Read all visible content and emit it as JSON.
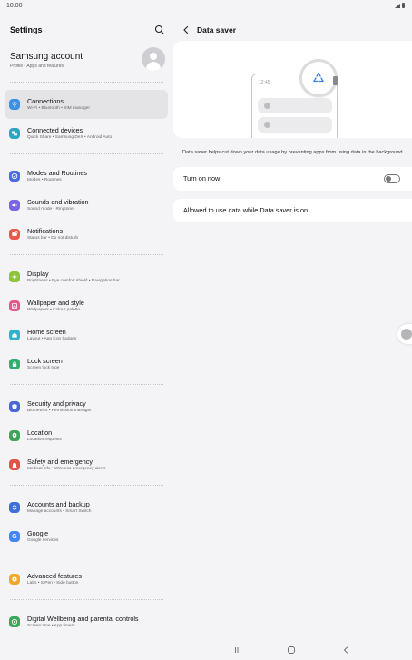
{
  "status_bar": {
    "time": "10.00"
  },
  "left": {
    "title": "Settings",
    "account": {
      "name": "Samsung account",
      "subtitle": "Profile • Apps and features"
    },
    "items": [
      {
        "label": "Connections",
        "sub": "Wi-Fi • Bluetooth • SIM manager",
        "icon": "wifi-icon",
        "color": "#3f8fe3"
      },
      {
        "label": "Connected devices",
        "sub": "Quick Share • Samsung DeX • Android Auto",
        "icon": "connected-devices-icon",
        "color": "#28a9c3"
      },
      {
        "label": "Modes and Routines",
        "sub": "Modes • Routines",
        "icon": "modes-icon",
        "color": "#4a6ce0"
      },
      {
        "label": "Sounds and vibration",
        "sub": "Sound mode • Ringtone",
        "icon": "sound-icon",
        "color": "#7b63e6"
      },
      {
        "label": "Notifications",
        "sub": "Status bar • Do not disturb",
        "icon": "notification-icon",
        "color": "#ea5a4c"
      },
      {
        "label": "Display",
        "sub": "Brightness • Eye comfort shield • Navigation bar",
        "icon": "display-icon",
        "color": "#8cc33a"
      },
      {
        "label": "Wallpaper and style",
        "sub": "Wallpapers • Colour palette",
        "icon": "wallpaper-icon",
        "color": "#e3588d"
      },
      {
        "label": "Home screen",
        "sub": "Layout • App icon badges",
        "icon": "home-icon",
        "color": "#2fb3c9"
      },
      {
        "label": "Lock screen",
        "sub": "Screen lock type",
        "icon": "lock-icon",
        "color": "#2fae6e"
      },
      {
        "label": "Security and privacy",
        "sub": "Biometrics • Permission manager",
        "icon": "shield-icon",
        "color": "#4a67d6"
      },
      {
        "label": "Location",
        "sub": "Location requests",
        "icon": "location-icon",
        "color": "#3ea45a"
      },
      {
        "label": "Safety and emergency",
        "sub": "Medical info • Wireless emergency alerts",
        "icon": "emergency-icon",
        "color": "#e0544a"
      },
      {
        "label": "Accounts and backup",
        "sub": "Manage accounts • Smart Switch",
        "icon": "sync-icon",
        "color": "#3f6fd8"
      },
      {
        "label": "Google",
        "sub": "Google services",
        "icon": "google-icon",
        "color": "#4285f4"
      },
      {
        "label": "Advanced features",
        "sub": "Labs • S Pen • Side button",
        "icon": "advanced-icon",
        "color": "#f2a72a"
      },
      {
        "label": "Digital Wellbeing and parental controls",
        "sub": "Screen time • App timers",
        "icon": "wellbeing-icon",
        "color": "#3aa85a"
      }
    ]
  },
  "right": {
    "title": "Data saver",
    "illustration_time": "12:45",
    "description": "Data saver helps cut down your data usage by preventing apps from using data in the background.",
    "turn_on_label": "Turn on now",
    "turn_on_state": false,
    "allowed_label": "Allowed to use data while Data saver is on"
  }
}
